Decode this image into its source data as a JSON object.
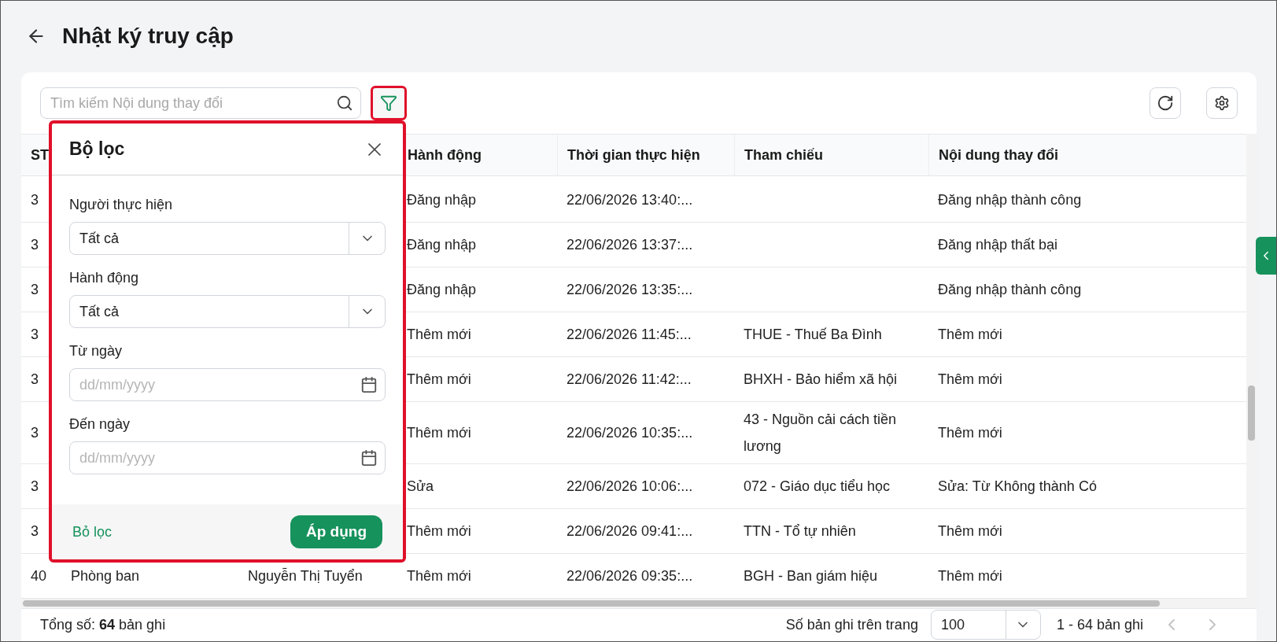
{
  "page": {
    "title": "Nhật ký truy cập"
  },
  "toolbar": {
    "search": {
      "placeholder": "Tìm kiếm Nội dung thay đổi"
    },
    "filter_button": {
      "highlighted": true
    }
  },
  "filter_panel": {
    "highlighted": true,
    "title": "Bộ lọc",
    "fields": [
      {
        "kind": "select",
        "label": "Người thực hiện",
        "value": "Tất cả"
      },
      {
        "kind": "select",
        "label": "Hành động",
        "value": "Tất cả"
      },
      {
        "kind": "date",
        "label": "Từ ngày",
        "placeholder": "dd/mm/yyyy"
      },
      {
        "kind": "date",
        "label": "Đến ngày",
        "placeholder": "dd/mm/yyyy"
      }
    ],
    "clear_button": "Bỏ lọc",
    "apply_button": "Áp dụng"
  },
  "table": {
    "columns": {
      "stt": "ST",
      "action": "Hành động",
      "time": "Thời gian thực hiện",
      "reference": "Tham chiếu",
      "content": "Nội dung thay đổi"
    },
    "rows": [
      {
        "stt": "3",
        "action": "Đăng nhập",
        "time": "22/06/2026 13:40:...",
        "content": "Đăng nhập thành công"
      },
      {
        "stt": "3",
        "action": "Đăng nhập",
        "time": "22/06/2026 13:37:...",
        "content": "Đăng nhập thất bại"
      },
      {
        "stt": "3",
        "action": "Đăng nhập",
        "time": "22/06/2026 13:35:...",
        "content": "Đăng nhập thành công"
      },
      {
        "stt": "3",
        "action": "Thêm mới",
        "time": "22/06/2026 11:45:...",
        "reference": "THUE - Thuế Ba Đình",
        "content": "Thêm mới"
      },
      {
        "stt": "3",
        "action": "Thêm mới",
        "time": "22/06/2026 11:42:...",
        "reference": "BHXH - Bảo hiểm xã hội",
        "content": "Thêm mới"
      },
      {
        "stt": "3",
        "action": "Thêm mới",
        "time": "22/06/2026 10:35:...",
        "reference": "43 - Nguồn cải cách tiền lương",
        "content": "Thêm mới"
      },
      {
        "stt": "3",
        "action": "Sửa",
        "time": "22/06/2026 10:06:...",
        "reference": "072 - Giáo dục tiểu học",
        "content": "Sửa: Từ Không thành Có"
      },
      {
        "stt": "3",
        "action": "Thêm mới",
        "time": "22/06/2026 09:41:...",
        "reference": "TTN - Tổ tự nhiên",
        "content": "Thêm mới"
      },
      {
        "stt": "40",
        "column_2": "Phòng ban",
        "column_3": "Nguyễn Thị Tuyển",
        "action": "Thêm mới",
        "time": "22/06/2026 09:35:...",
        "reference": "BGH - Ban giám hiệu",
        "content": "Thêm mới"
      }
    ]
  },
  "footer": {
    "total": "Tổng số: **64** bản ghi",
    "page_size_label": "Số bản ghi trên trang",
    "page_size": "100",
    "range": "1 - 64 bản ghi"
  }
}
